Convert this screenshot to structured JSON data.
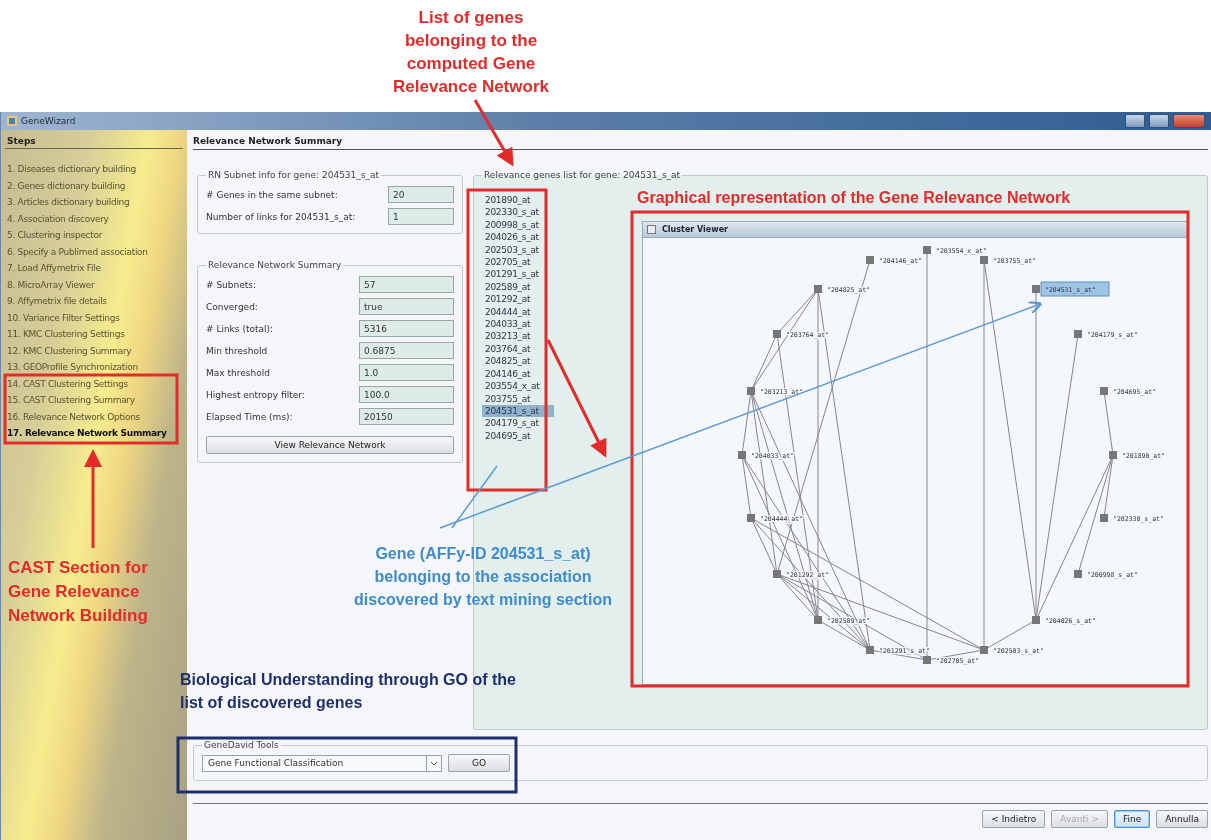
{
  "window": {
    "title": "GeneWizard"
  },
  "sidebar": {
    "heading": "Steps",
    "items": [
      {
        "label": "1. Diseases dictionary building",
        "selected": false
      },
      {
        "label": "2. Genes dictionary building",
        "selected": false
      },
      {
        "label": "3. Articles dictionary building",
        "selected": false
      },
      {
        "label": "4. Association discovery",
        "selected": false
      },
      {
        "label": "5. Clustering inspector",
        "selected": false
      },
      {
        "label": "6. Specify a Publimed association",
        "selected": false
      },
      {
        "label": "7. Load Affymetrix File",
        "selected": false
      },
      {
        "label": "8. MicroArray Viewer",
        "selected": false
      },
      {
        "label": "9. Affymetrix file details",
        "selected": false
      },
      {
        "label": "10. Variance Filter Settings",
        "selected": false
      },
      {
        "label": "11. KMC Clustering Settings",
        "selected": false
      },
      {
        "label": "12. KMC Clustering Summary",
        "selected": false
      },
      {
        "label": "13. GEOProfile Synchronization",
        "selected": false
      },
      {
        "label": "14. CAST Clustering Settings",
        "selected": false
      },
      {
        "label": "15. CAST Clustering Summary",
        "selected": false
      },
      {
        "label": "16. Relevance Network Options",
        "selected": false
      },
      {
        "label": "17. Relevance Network Summary",
        "selected": true
      }
    ]
  },
  "page_title": "Relevance Network Summary",
  "subnet_info": {
    "title": "RN Subnet info for gene: 204531_s_at",
    "fields": [
      {
        "label": "# Genes in the same subnet:",
        "value": "20"
      },
      {
        "label": "Number of links for 204531_s_at:",
        "value": "1"
      }
    ]
  },
  "network_summary": {
    "title": "Relevance Network Summary",
    "fields": [
      {
        "label": "# Subnets:",
        "value": "57"
      },
      {
        "label": "Converged:",
        "value": "true"
      },
      {
        "label": "# Links (total):",
        "value": "5316"
      },
      {
        "label": "Min threshold",
        "value": "0.6875"
      },
      {
        "label": "Max threshold",
        "value": "1.0"
      },
      {
        "label": "Highest entropy filter:",
        "value": "100.0"
      },
      {
        "label": "Elapsed Time (ms):",
        "value": "20150"
      }
    ],
    "button": "View Relevance Network"
  },
  "genes_list": {
    "title": "Relevance genes list for gene: 204531_s_at",
    "items": [
      {
        "label": "201890_at",
        "selected": false
      },
      {
        "label": "202330_s_at",
        "selected": false
      },
      {
        "label": "200998_s_at",
        "selected": false
      },
      {
        "label": "204026_s_at",
        "selected": false
      },
      {
        "label": "202503_s_at",
        "selected": false
      },
      {
        "label": "202705_at",
        "selected": false
      },
      {
        "label": "201291_s_at",
        "selected": false
      },
      {
        "label": "202589_at",
        "selected": false
      },
      {
        "label": "201292_at",
        "selected": false
      },
      {
        "label": "204444_at",
        "selected": false
      },
      {
        "label": "204033_at",
        "selected": false
      },
      {
        "label": "203213_at",
        "selected": false
      },
      {
        "label": "203764_at",
        "selected": false
      },
      {
        "label": "204825_at",
        "selected": false
      },
      {
        "label": "204146_at",
        "selected": false
      },
      {
        "label": "203554_x_at",
        "selected": false
      },
      {
        "label": "203755_at",
        "selected": false
      },
      {
        "label": "204531_s_at",
        "selected": true
      },
      {
        "label": "204179_s_at",
        "selected": false
      },
      {
        "label": "204695_at",
        "selected": false
      }
    ]
  },
  "cluster_viewer": {
    "title": "Cluster Viewer",
    "nodes": [
      {
        "label": "\"203554_x_at\"",
        "selected": false
      },
      {
        "label": "\"204146_at\"",
        "selected": false
      },
      {
        "label": "\"203755_at\"",
        "selected": false
      },
      {
        "label": "\"204825_at\"",
        "selected": false
      },
      {
        "label": "\"204531_s_at\"",
        "selected": true
      },
      {
        "label": "\"203764_at\"",
        "selected": false
      },
      {
        "label": "\"204179_s_at\"",
        "selected": false
      },
      {
        "label": "\"203213_at\"",
        "selected": false
      },
      {
        "label": "\"204695_at\"",
        "selected": false
      },
      {
        "label": "\"204033_at\"",
        "selected": false
      },
      {
        "label": "\"201890_at\"",
        "selected": false
      },
      {
        "label": "\"204444_at\"",
        "selected": false
      },
      {
        "label": "\"202330_s_at\"",
        "selected": false
      },
      {
        "label": "\"201292_at\"",
        "selected": false
      },
      {
        "label": "\"200998_s_at\"",
        "selected": false
      },
      {
        "label": "\"202589_at\"",
        "selected": false
      },
      {
        "label": "\"204026_s_at\"",
        "selected": false
      },
      {
        "label": "\"201291_s_at\"",
        "selected": false
      },
      {
        "label": "\"202503_s_at\"",
        "selected": false
      },
      {
        "label": "\"202705_at\"",
        "selected": false
      }
    ]
  },
  "gene_david": {
    "title": "GeneDavid Tools",
    "select": "Gene Functional Classification",
    "button": "GO"
  },
  "nav_buttons": [
    {
      "label": "< Indietro",
      "disabled": false,
      "focused": false
    },
    {
      "label": "Avanti >",
      "disabled": true,
      "focused": false
    },
    {
      "label": "Fine",
      "disabled": false,
      "focused": true
    },
    {
      "label": "Annulla",
      "disabled": false,
      "focused": false
    }
  ],
  "annotations": {
    "genes_list_note": "List of genes belonging to the computed Gene Relevance Network",
    "graph_note": "Graphical representation of the Gene Relevance Network",
    "cast_note": "CAST Section for Gene Relevance Network Building",
    "gene_note": "Gene (AFFy-ID 204531_s_at) belonging to the association discovered by text mining section",
    "go_note": "Biological Understanding through GO of the list of discovered genes"
  }
}
